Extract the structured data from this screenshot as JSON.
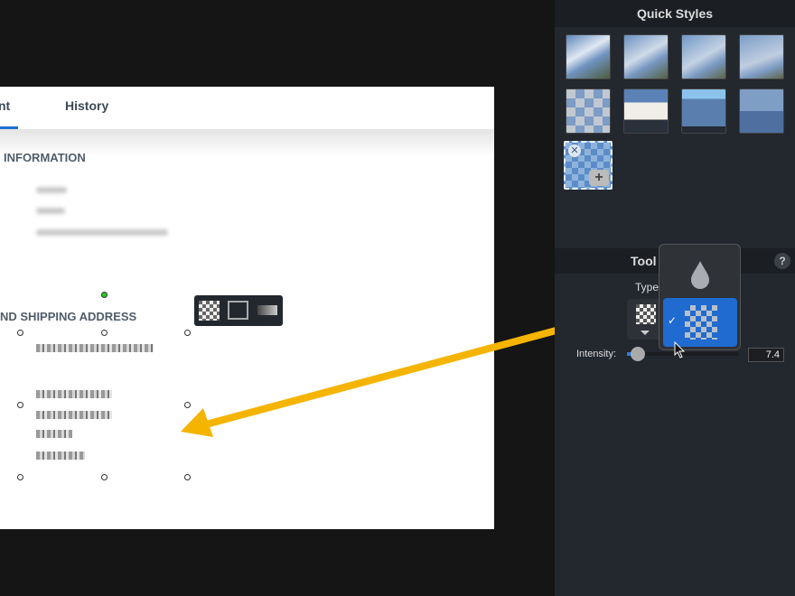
{
  "document": {
    "tabs": [
      {
        "label": "nt",
        "active": true
      },
      {
        "label": "History",
        "active": false
      }
    ],
    "section1_title": "INFORMATION",
    "section2_title": "ND SHIPPING ADDRESS"
  },
  "panel": {
    "quick_styles_title": "Quick Styles",
    "tool_title": "Tool",
    "help_label": "?",
    "type_label": "Type",
    "intensity_label": "Intensity:",
    "intensity_value": "7.4",
    "dropdown_options": [
      {
        "icon": "blur-drop-icon",
        "selected": false
      },
      {
        "icon": "pixelate-icon",
        "selected": true,
        "check": "✓"
      }
    ]
  },
  "colors": {
    "accent": "#1f6fd0",
    "arrow": "#f5b400",
    "panel": "#23272e"
  }
}
